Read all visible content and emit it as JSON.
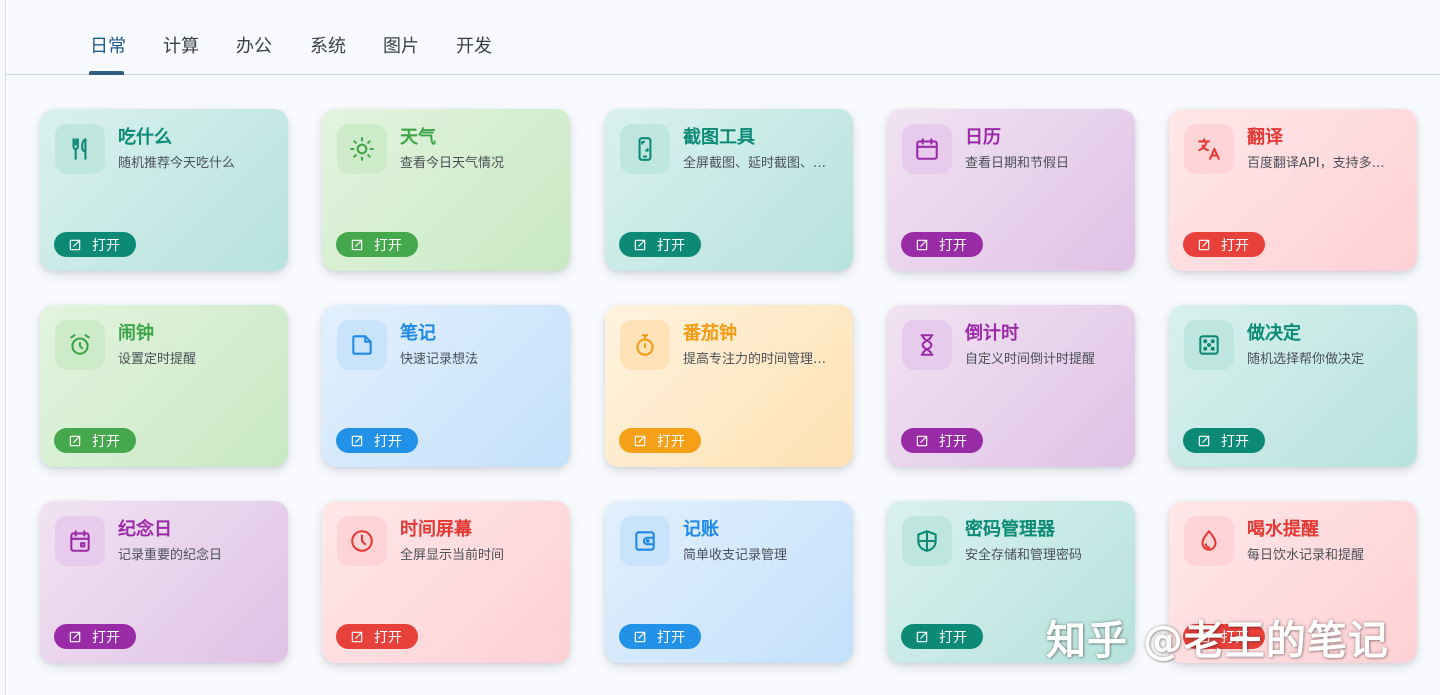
{
  "tabs": [
    {
      "label": "日常",
      "active": true
    },
    {
      "label": "计算",
      "active": false
    },
    {
      "label": "办公",
      "active": false
    },
    {
      "label": "系统",
      "active": false
    },
    {
      "label": "图片",
      "active": false
    },
    {
      "label": "开发",
      "active": false
    }
  ],
  "open_label": "打开",
  "cards": [
    {
      "title": "吃什么",
      "desc": "随机推荐今天吃什么",
      "icon": "utensils-icon",
      "theme": "teal"
    },
    {
      "title": "天气",
      "desc": "查看今日天气情况",
      "icon": "sun-icon",
      "theme": "green"
    },
    {
      "title": "截图工具",
      "desc": "全屏截图、延时截图、…",
      "icon": "screenshot-icon",
      "theme": "teal"
    },
    {
      "title": "日历",
      "desc": "查看日期和节假日",
      "icon": "calendar-icon",
      "theme": "purple"
    },
    {
      "title": "翻译",
      "desc": "百度翻译API，支持多…",
      "icon": "translate-icon",
      "theme": "red"
    },
    {
      "title": "闹钟",
      "desc": "设置定时提醒",
      "icon": "alarm-icon",
      "theme": "green"
    },
    {
      "title": "笔记",
      "desc": "快速记录想法",
      "icon": "note-icon",
      "theme": "blue"
    },
    {
      "title": "番茄钟",
      "desc": "提高专注力的时间管理…",
      "icon": "stopwatch-icon",
      "theme": "orange"
    },
    {
      "title": "倒计时",
      "desc": "自定义时间倒计时提醒",
      "icon": "hourglass-icon",
      "theme": "purple"
    },
    {
      "title": "做决定",
      "desc": "随机选择帮你做决定",
      "icon": "dice-icon",
      "theme": "teal"
    },
    {
      "title": "纪念日",
      "desc": "记录重要的纪念日",
      "icon": "calendar-event-icon",
      "theme": "purple"
    },
    {
      "title": "时间屏幕",
      "desc": "全屏显示当前时间",
      "icon": "clock-icon",
      "theme": "red"
    },
    {
      "title": "记账",
      "desc": "简单收支记录管理",
      "icon": "wallet-icon",
      "theme": "blue"
    },
    {
      "title": "密码管理器",
      "desc": "安全存储和管理密码",
      "icon": "shield-icon",
      "theme": "teal"
    },
    {
      "title": "喝水提醒",
      "desc": "每日饮水记录和提醒",
      "icon": "water-drop-icon",
      "theme": "red"
    }
  ],
  "watermark": "知乎 @老王的笔记"
}
